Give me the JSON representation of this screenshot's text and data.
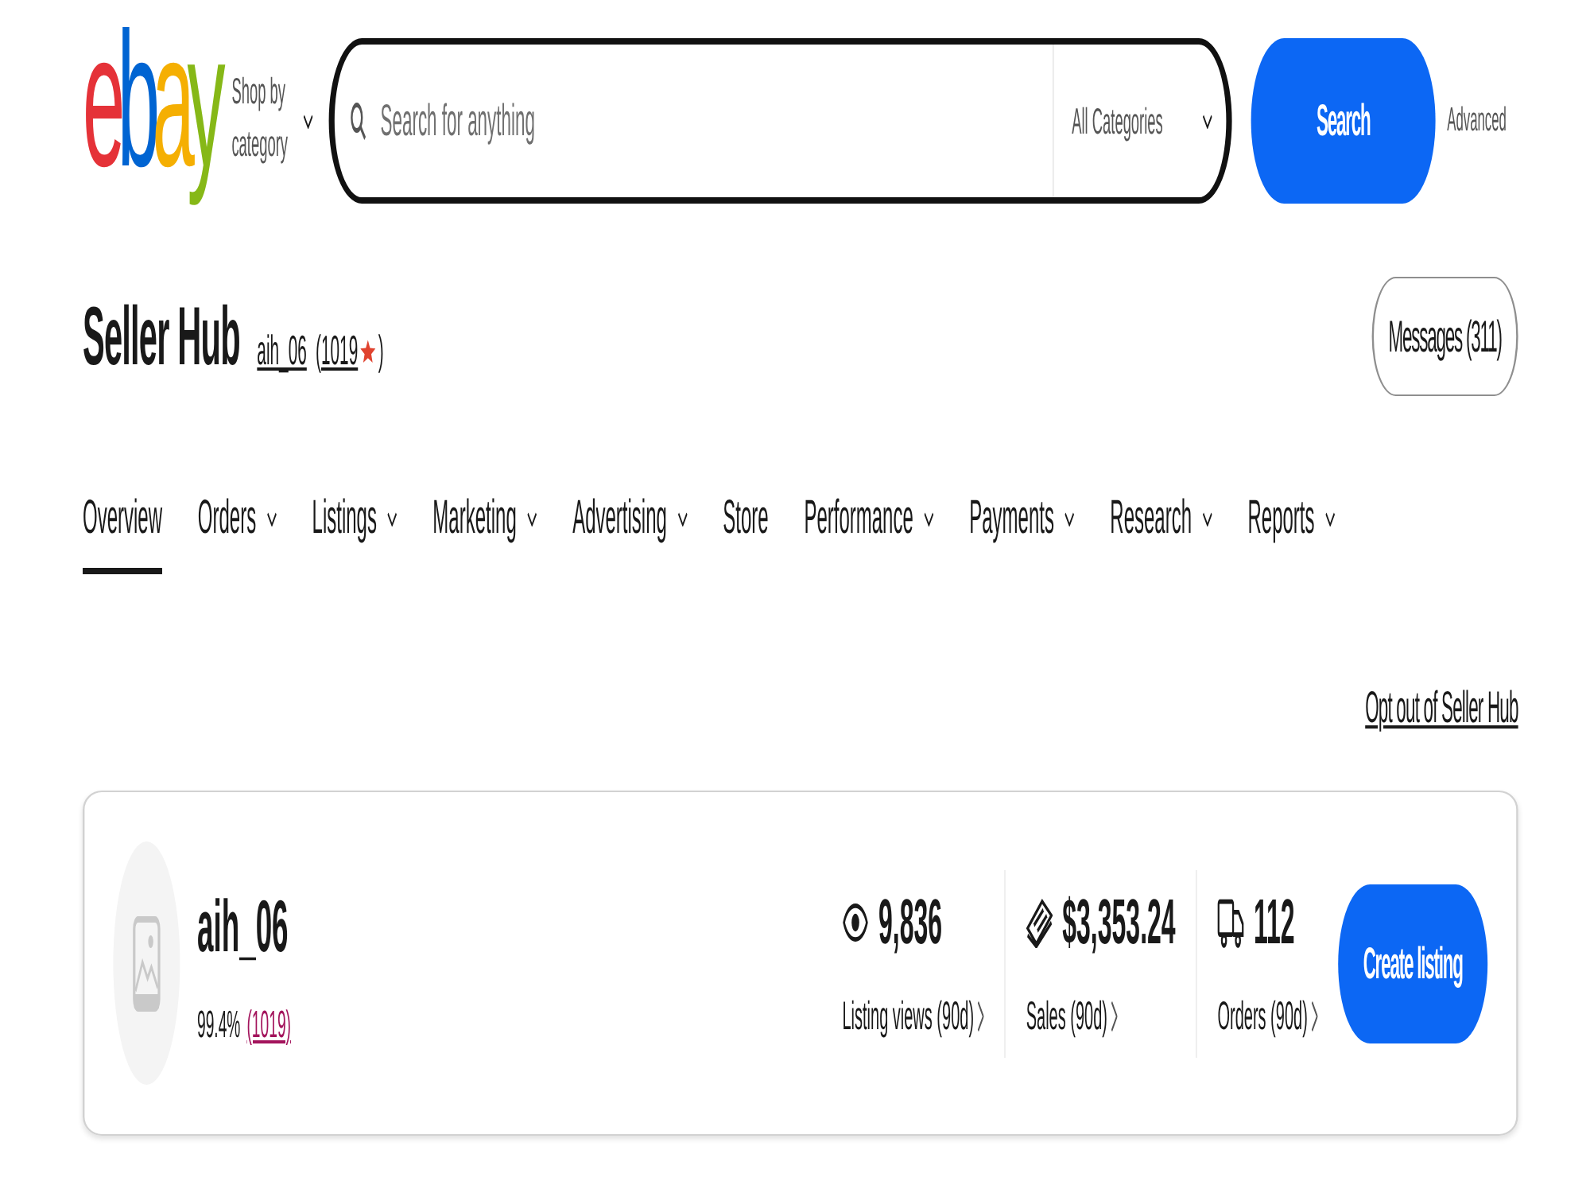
{
  "header": {
    "logo": "ebay",
    "shop_by_category": "Shop by category",
    "search": {
      "placeholder": "Search for anything",
      "category": "All Categories",
      "button": "Search"
    },
    "advanced": "Advanced"
  },
  "hub": {
    "title": "Seller Hub",
    "username": "aih_06",
    "feedback": {
      "prefix": "(",
      "score": "1019",
      "suffix": ")"
    },
    "messages_button": "Messages (311)"
  },
  "nav": {
    "tabs": [
      {
        "label": "Overview",
        "selected": true,
        "has_menu": false
      },
      {
        "label": "Orders",
        "selected": false,
        "has_menu": true
      },
      {
        "label": "Listings",
        "selected": false,
        "has_menu": true
      },
      {
        "label": "Marketing",
        "selected": false,
        "has_menu": true
      },
      {
        "label": "Advertising",
        "selected": false,
        "has_menu": true
      },
      {
        "label": "Store",
        "selected": false,
        "has_menu": false
      },
      {
        "label": "Performance",
        "selected": false,
        "has_menu": true
      },
      {
        "label": "Payments",
        "selected": false,
        "has_menu": true
      },
      {
        "label": "Research",
        "selected": false,
        "has_menu": true
      },
      {
        "label": "Reports",
        "selected": false,
        "has_menu": true
      }
    ]
  },
  "opt_out_link": "Opt out of Seller Hub",
  "seller_card": {
    "username": "aih_06",
    "positive_feedback": "99.4%",
    "feedback_link": "(1019)",
    "stats": [
      {
        "kind": "views",
        "value": "9,836",
        "label": "Listing views (90d)"
      },
      {
        "kind": "sales",
        "value": "$3,353.24",
        "label": "Sales (90d)"
      },
      {
        "kind": "orders",
        "value": "112",
        "label": "Orders (90d)"
      }
    ],
    "create_button": "Create listing"
  }
}
